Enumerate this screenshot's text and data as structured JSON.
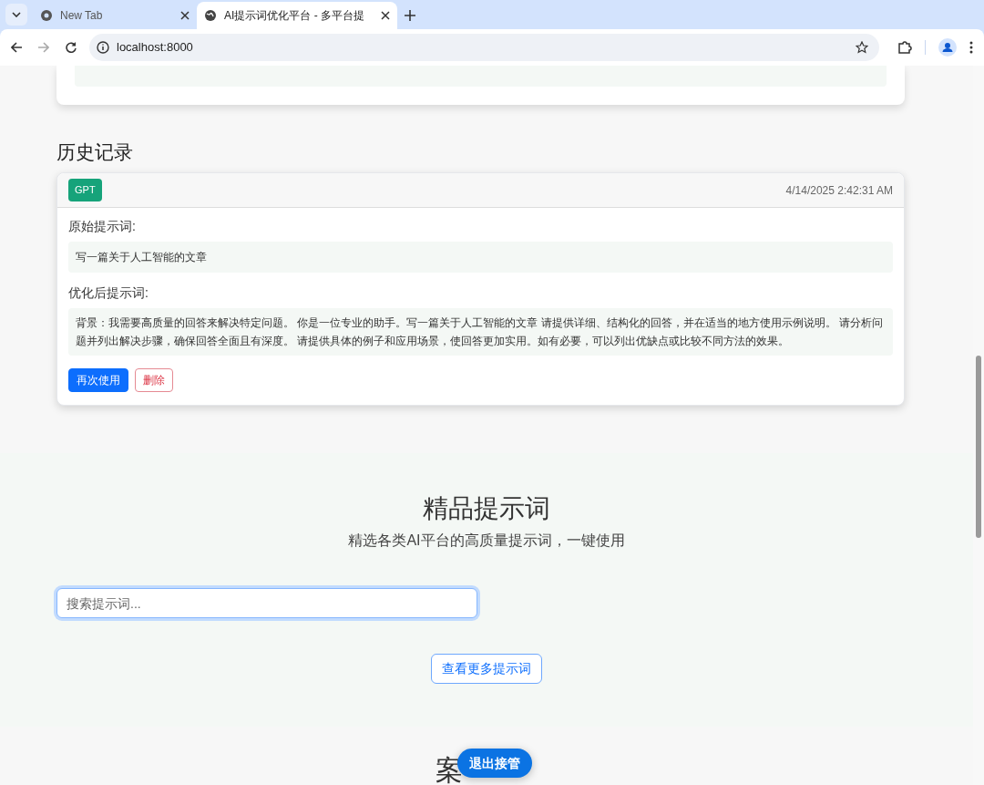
{
  "browser": {
    "tabs": [
      {
        "title": "New Tab",
        "selected": false,
        "kind": "chrome"
      },
      {
        "title": "AI提示词优化平台 - 多平台提",
        "selected": true,
        "kind": "globe"
      }
    ],
    "address": "localhost:8000"
  },
  "history": {
    "heading": "历史记录",
    "items": [
      {
        "badge": "GPT",
        "color": "#16a37a",
        "time": "4/14/2025 2:42:31 AM",
        "original_label": "原始提示词:",
        "original": "写一篇关于人工智能的文章",
        "optimized_label": "优化后提示词:",
        "optimized": "背景：我需要高质量的回答来解决特定问题。 你是一位专业的助手。写一篇关于人工智能的文章 请提供详细、结构化的回答，并在适当的地方使用示例说明。 请分析问题并列出解决步骤，确保回答全面且有深度。 请提供具体的例子和应用场景，使回答更加实用。如有必要，可以列出优缺点或比较不同方法的效果。",
        "buttons": [
          {
            "label": "再次使用",
            "kind": "primary"
          },
          {
            "label": "删除",
            "kind": "danger"
          }
        ]
      }
    ]
  },
  "featured": {
    "title": "精品提示词",
    "subtitle": "精选各类AI平台的高质量提示词，一键使用",
    "search": {
      "placeholder": "搜索提示词...",
      "focused": true
    },
    "more_button": "查看更多提示词"
  },
  "cases": {
    "title": "案"
  },
  "floating_button": "退出接管"
}
